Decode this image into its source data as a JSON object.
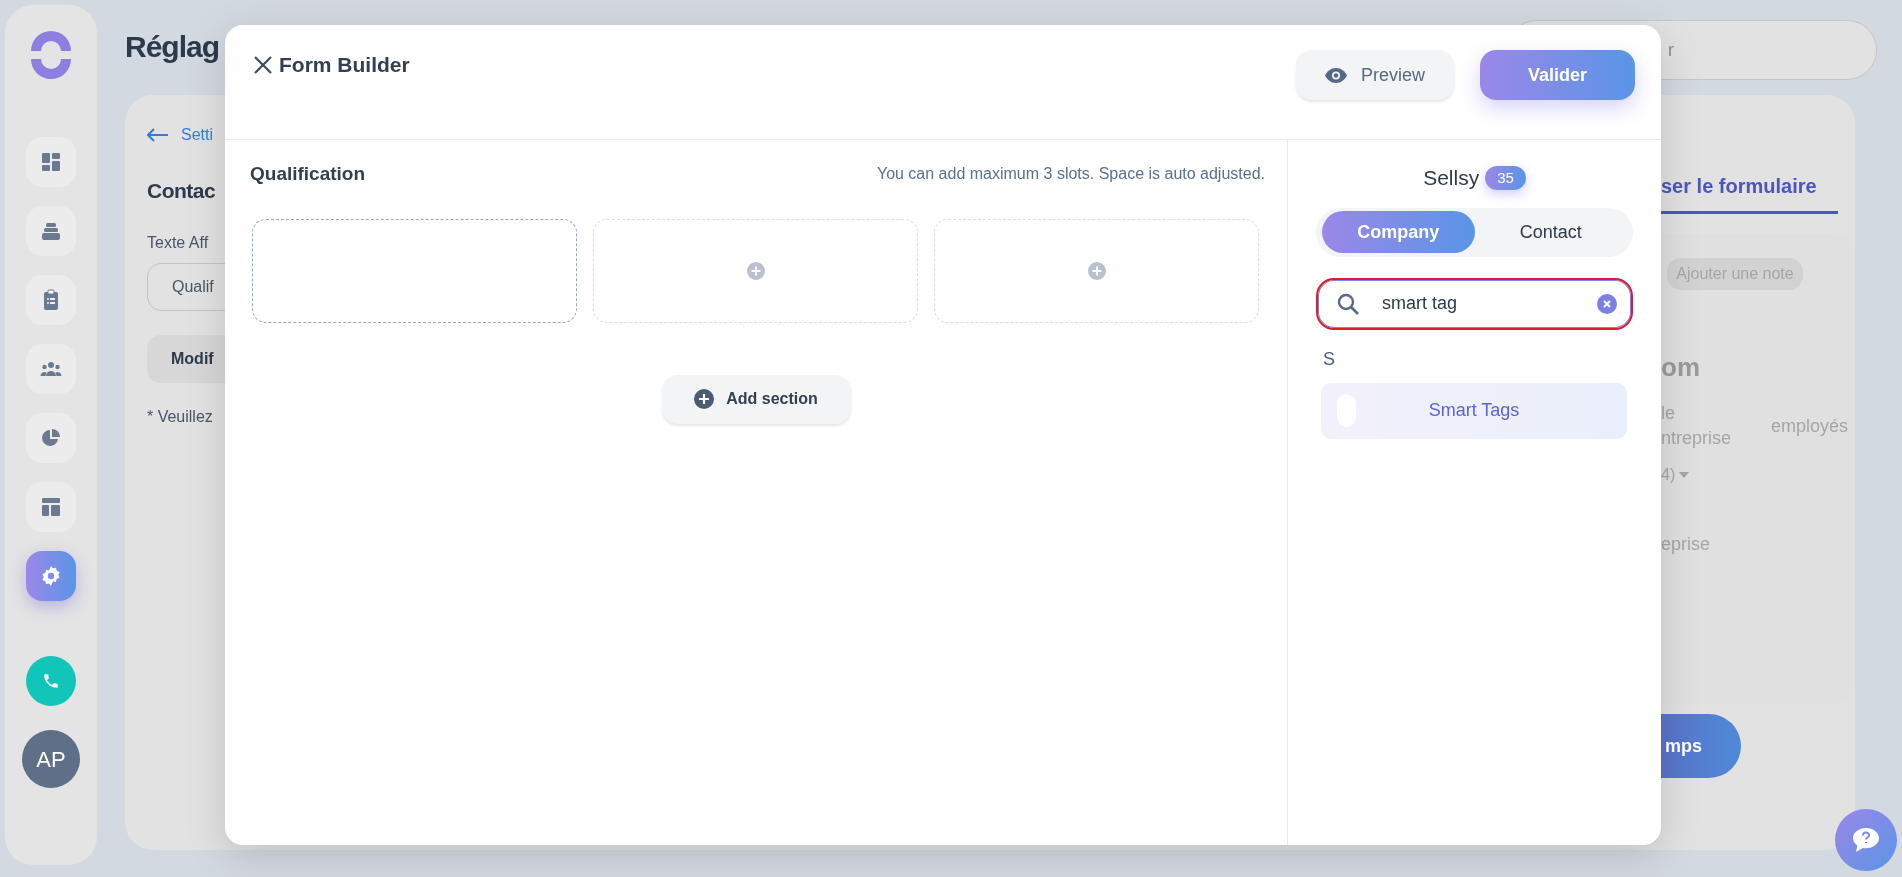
{
  "sidebar": {
    "items": [
      {
        "selected": false
      },
      {
        "selected": false
      },
      {
        "selected": false
      },
      {
        "selected": false
      },
      {
        "selected": false
      },
      {
        "selected": false
      },
      {
        "selected": true
      }
    ],
    "avatar": "AP"
  },
  "background": {
    "title": "Réglag",
    "back_link": "Setti",
    "heading": "Contac",
    "field_label": "Texte Aff",
    "field_value": "Qualif",
    "button": "Modif",
    "note": "* Veuillez",
    "search_fragment": "r",
    "tab_fragment": "ser le formulaire",
    "add_note_button": "Ajouter une note",
    "heading_fragment": "om",
    "label_fragment_1": "le",
    "label_fragment_2": "ntreprise",
    "column_label": "employés",
    "select_fragment": "4)",
    "text_fragment": "eprise",
    "save_button_fragment": "mps"
  },
  "modal": {
    "title": "Form Builder",
    "preview_button": "Preview",
    "validate_button": "Valider",
    "section": {
      "title": "Qualification",
      "hint": "You can add maximum 3 slots. Space is auto adjusted.",
      "slots": [
        {
          "kind": "drop_target"
        },
        {
          "kind": "empty"
        },
        {
          "kind": "empty"
        }
      ],
      "add_button": "Add section"
    },
    "panel": {
      "source": "Sellsy",
      "count": "35",
      "tabs": [
        {
          "label": "Company",
          "selected": true
        },
        {
          "label": "Contact",
          "selected": false
        }
      ],
      "search": {
        "value": "smart tag"
      },
      "groups": [
        {
          "letter": "S",
          "items": [
            {
              "label": "Smart Tags"
            }
          ]
        }
      ]
    }
  }
}
